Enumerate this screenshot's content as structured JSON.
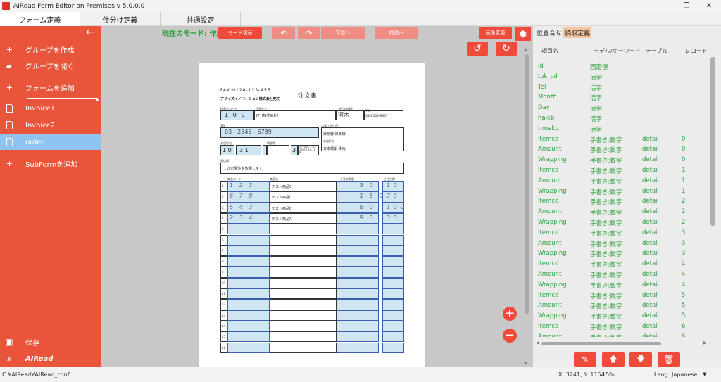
{
  "window": {
    "title": "AIRead Form Editor on Premises v 5.0.0.0"
  },
  "menu": {
    "tabs": [
      "フォーム定義",
      "仕分け定義",
      "共通設定"
    ]
  },
  "sidebar": {
    "create_group": "グループを作成",
    "open_group": "グループを開く",
    "add_form": "フォームを追加",
    "forms": [
      "Invoice1",
      "Invoice2",
      "order"
    ],
    "add_subform": "SubFormを追加",
    "save": "保存",
    "brand": "AIRead"
  },
  "toolbar": {
    "mode_label": "現在のモード: 作成",
    "mode_switch": "モード切替",
    "undo_icon": "undo-icon",
    "redo_icon": "redo-icon",
    "btn_prev": "下位へ",
    "btn_next": "前位へ",
    "image_change": "画像変更"
  },
  "document": {
    "fax": "FAX:0120-123-456",
    "title": "注文書",
    "company": "アライズイノベーション株式会社宛て",
    "labels": [
      "得意先コード",
      "得意先名",
      "ご担当者様名",
      "TEL",
      "お届け日",
      "お届け先住所",
      "時間帯",
      "お届け先",
      "通信欄"
    ],
    "tok_code": "1 0 0",
    "tok_name": "IT（株式会社）",
    "contact": "河木",
    "tel_small": "03-6554-9667",
    "tel": "03 - 2345 - 6789",
    "address": "東京都 日本橋",
    "delivery_to": "日本橋駅 構内",
    "month": "1 0",
    "day": "3 1",
    "time_slot": "3",
    "time_opts": "1:午前中 2:14-16時 3:16-18時",
    "notes": "1 次の発注を依頼します。",
    "table_headers": [
      "商品コード",
      "商品名",
      "ご注文数量",
      "ご注文数"
    ],
    "rows": [
      {
        "code": "1 2 3",
        "name": "テスト商品C",
        "qty": "3 0",
        "num": "1 0"
      },
      {
        "code": "6 7 8",
        "name": "テスト商品C",
        "qty": "1 5 0",
        "num": "7 0"
      },
      {
        "code": "5 4 3",
        "name": "テスト商品B",
        "qty": "8 0",
        "num": "1 0 0"
      },
      {
        "code": "2 3 4",
        "name": "テスト商品A",
        "qty": "9 3",
        "num": "3 0"
      }
    ],
    "row_numbers": [
      "1",
      "2",
      "3",
      "4",
      "5",
      "6",
      "7",
      "8",
      "9",
      "10",
      "11",
      "12",
      "13",
      "14",
      "15",
      "16"
    ]
  },
  "right_panel": {
    "tabs": [
      "位置合せ",
      "読取定義"
    ],
    "columns": [
      "項目名",
      "モデル/キーワード",
      "テーブル",
      "レコード"
    ],
    "rows": [
      {
        "name": "id",
        "model": "固定値",
        "table": "",
        "rec": ""
      },
      {
        "name": "tok_cd",
        "model": "活字",
        "table": "",
        "rec": ""
      },
      {
        "name": "Tel",
        "model": "活字",
        "table": "",
        "rec": ""
      },
      {
        "name": "Month",
        "model": "活字",
        "table": "",
        "rec": ""
      },
      {
        "name": "Day",
        "model": "活字",
        "table": "",
        "rec": ""
      },
      {
        "name": "haikb",
        "model": "活字",
        "table": "",
        "rec": ""
      },
      {
        "name": "timekb",
        "model": "活字",
        "table": "",
        "rec": ""
      },
      {
        "name": "Itemcd",
        "model": "手書き:数字",
        "table": "detail",
        "rec": "0"
      },
      {
        "name": "Amount",
        "model": "手書き:数字",
        "table": "detail",
        "rec": "0"
      },
      {
        "name": "Wrapping",
        "model": "手書き:数字",
        "table": "detail",
        "rec": "0"
      },
      {
        "name": "Itemcd",
        "model": "手書き:数字",
        "table": "detail",
        "rec": "1"
      },
      {
        "name": "Amount",
        "model": "手書き:数字",
        "table": "detail",
        "rec": "1"
      },
      {
        "name": "Wrapping",
        "model": "手書き:数字",
        "table": "detail",
        "rec": "1"
      },
      {
        "name": "Itemcd",
        "model": "手書き:数字",
        "table": "detail",
        "rec": "2"
      },
      {
        "name": "Amount",
        "model": "手書き:数字",
        "table": "detail",
        "rec": "2"
      },
      {
        "name": "Wrapping",
        "model": "手書き:数字",
        "table": "detail",
        "rec": "2"
      },
      {
        "name": "Itemcd",
        "model": "手書き:数字",
        "table": "detail",
        "rec": "3"
      },
      {
        "name": "Amount",
        "model": "手書き:数字",
        "table": "detail",
        "rec": "3"
      },
      {
        "name": "Wrapping",
        "model": "手書き:数字",
        "table": "detail",
        "rec": "3"
      },
      {
        "name": "Itemcd",
        "model": "手書き:数字",
        "table": "detail",
        "rec": "4"
      },
      {
        "name": "Amount",
        "model": "手書き:数字",
        "table": "detail",
        "rec": "4"
      },
      {
        "name": "Wrapping",
        "model": "手書き:数字",
        "table": "detail",
        "rec": "4"
      },
      {
        "name": "Itemcd",
        "model": "手書き:数字",
        "table": "detail",
        "rec": "5"
      },
      {
        "name": "Amount",
        "model": "手書き:数字",
        "table": "detail",
        "rec": "5"
      },
      {
        "name": "Wrapping",
        "model": "手書き:数字",
        "table": "detail",
        "rec": "5"
      },
      {
        "name": "Itemcd",
        "model": "手書き:数字",
        "table": "detail",
        "rec": "6"
      },
      {
        "name": "Amount",
        "model": "手書き:数字",
        "table": "detail",
        "rec": "6"
      }
    ]
  },
  "status": {
    "path": "C:¥AIRead¥AIRead_conf",
    "coords": "X: 3241; Y: 1154",
    "zoom": "15%",
    "lang_label": "Lang :",
    "lang_value": "Japanese"
  },
  "colors": {
    "accent": "#ef4a3a",
    "sidebar": "#e8553a",
    "selected": "#8fc4f1",
    "green_text": "#2da03a"
  }
}
